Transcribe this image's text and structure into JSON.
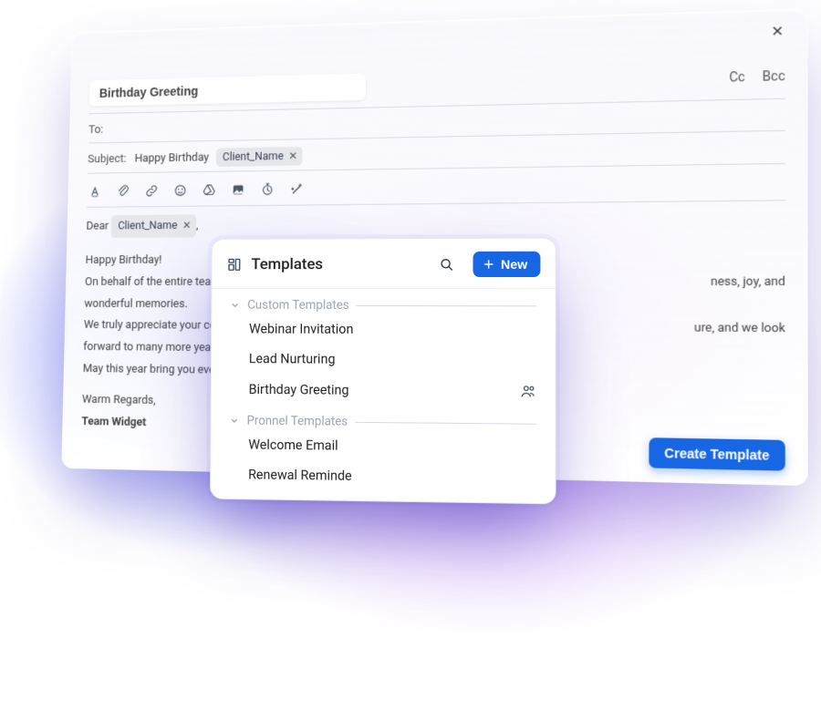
{
  "compose": {
    "title": "Birthday Greeting",
    "cc_label": "Cc",
    "bcc_label": "Bcc",
    "to_label": "To:",
    "subject_label": "Subject:",
    "subject_text": "Happy Birthday",
    "subject_chip": "Client_Name",
    "body": {
      "greeting_prefix": "Dear",
      "greeting_chip": "Client_Name",
      "greeting_suffix": ",",
      "line1": "Happy Birthday!",
      "line2a": "On behalf of the entire team",
      "line2b": "ness, joy, and",
      "line3": "wonderful memories.",
      "line4a": "We truly appreciate your con",
      "line4b": "ure, and we look",
      "line5": "forward to many more years",
      "line6": "May this year bring you even",
      "signoff": "Warm Regards,",
      "team": "Team Widget"
    },
    "create_template_label": "Create Template"
  },
  "popover": {
    "title": "Templates",
    "new_label": "New",
    "sections": [
      {
        "label": "Custom Templates",
        "items": [
          {
            "label": "Webinar Invitation",
            "shared": false
          },
          {
            "label": "Lead Nurturing",
            "shared": false
          },
          {
            "label": "Birthday Greeting",
            "shared": true
          }
        ]
      },
      {
        "label": "Pronnel Templates",
        "items": [
          {
            "label": "Welcome Email",
            "shared": false
          },
          {
            "label": "Renewal Reminde",
            "shared": false
          }
        ]
      }
    ]
  },
  "colors": {
    "accent": "#1767e5"
  }
}
